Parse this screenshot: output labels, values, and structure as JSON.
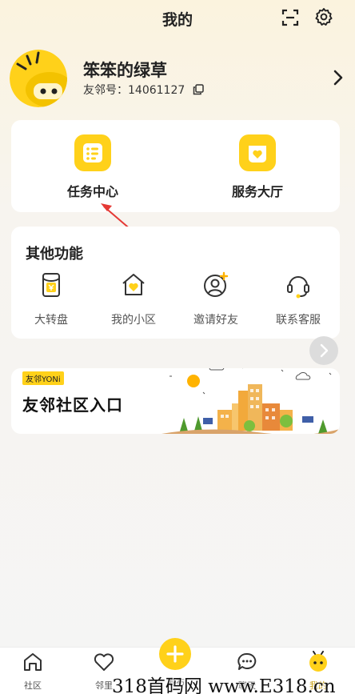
{
  "header": {
    "title": "我的"
  },
  "profile": {
    "nickname": "笨笨的绿草",
    "uid": "友邻号：14061127"
  },
  "entries": [
    {
      "label": "任务中心"
    },
    {
      "label": "服务大厅"
    }
  ],
  "other": {
    "title": "其他功能",
    "items": [
      {
        "label": "大转盘"
      },
      {
        "label": "我的小区"
      },
      {
        "label": "邀请好友"
      },
      {
        "label": "联系客服"
      }
    ]
  },
  "banner": {
    "tag": "友邻YONi",
    "title": "友邻社区入口"
  },
  "tabbar": {
    "items": [
      {
        "label": "社区"
      },
      {
        "label": "邻里"
      },
      {
        "label": "发布"
      },
      {
        "label": "聊天"
      },
      {
        "label": "我的"
      }
    ]
  },
  "watermark": "318首码网 www.E318.cn",
  "colors": {
    "accent": "#ffd11a",
    "annotation": "#e53935"
  }
}
